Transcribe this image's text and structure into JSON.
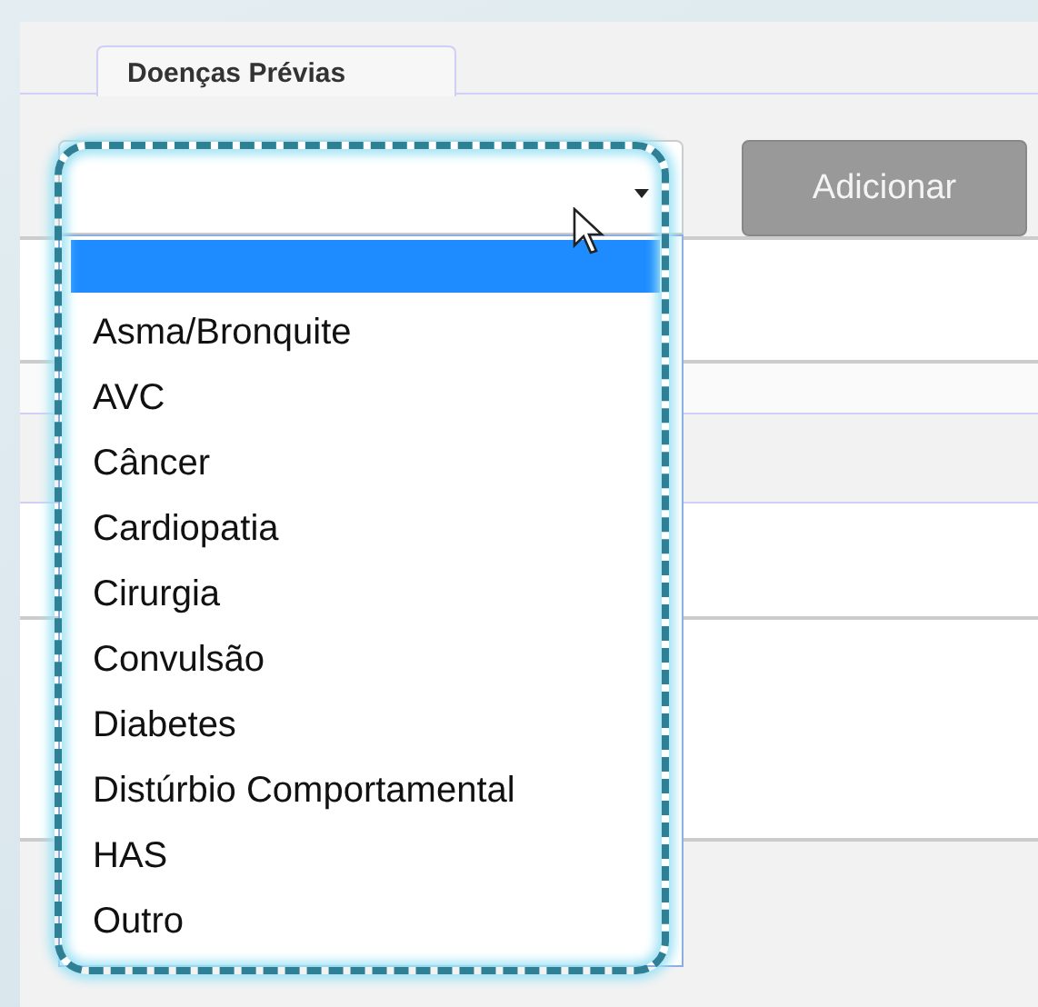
{
  "tabs": [
    {
      "label": "Doenças Prévias",
      "selected": true
    }
  ],
  "disease_select": {
    "expanded": true,
    "options": [
      {
        "selected": true
      },
      {
        "label": "Asma/Bronquite",
        "selected": false
      },
      {
        "label": "AVC",
        "selected": false
      },
      {
        "label": "Câncer",
        "selected": false
      },
      {
        "label": "Cardiopatia",
        "selected": false
      },
      {
        "label": "Cirurgia",
        "selected": false
      },
      {
        "label": "Convulsão",
        "selected": false
      },
      {
        "label": "Diabetes",
        "selected": false
      },
      {
        "label": "Distúrbio Comportamental",
        "selected": false
      },
      {
        "label": "HAS",
        "selected": false
      },
      {
        "label": "Outro",
        "selected": false
      }
    ]
  },
  "add_button": {
    "label": "Adicionar",
    "disabled": true
  }
}
